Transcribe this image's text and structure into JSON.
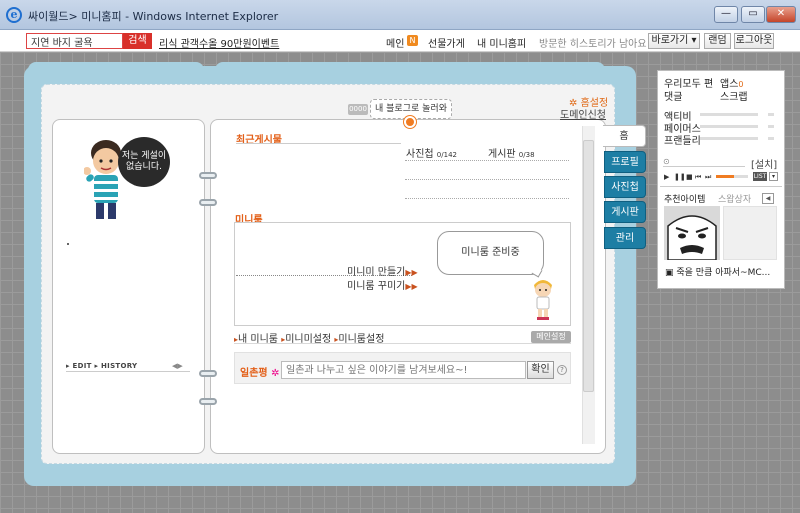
{
  "window": {
    "title": "싸이월드> 미니홈피 - Windows Internet Explorer",
    "btn_minimize": "—",
    "btn_maximize": "▭",
    "btn_close": "✕"
  },
  "topbar": {
    "search_value": "지연 바지 굴욕",
    "search_button": "검색",
    "promo_link": "리식 관객수올 90만원이벤트",
    "nav": {
      "main": "메인",
      "new_badge": "N",
      "gift_shop": "선물가게",
      "my_minihompy": "내 미니홈피",
      "visit_history": "방문한 히스토리가 남아요",
      "shortcut": "바로가기 ▾",
      "random": "랜덤",
      "logout": "로그아웃"
    }
  },
  "left_page": {
    "speech_text": "저는 게설이 없습니다.",
    "edit_history": "▸ EDIT  ▸ HISTORY"
  },
  "header": {
    "counter": "0000",
    "blog_banner": "내 블로그로 놀러와",
    "home_settings": "✲ 홈설정",
    "domain_apply": "도메인신청"
  },
  "recent": {
    "title": "최근게시물",
    "photo_label": "사진첩",
    "photo_count": "0/142",
    "board_label": "게시판",
    "board_count": "0/38"
  },
  "miniroom": {
    "title": "미니룸",
    "bubble": "미니룸 준비중",
    "make_link": "미니미 만들기",
    "decorate_link": "미니룸 꾸미기",
    "tab_my_room": "내 미니룸",
    "tab_minimi_settings": "미니미설정",
    "tab_room_settings": "미니룸설정",
    "main_set_button": "메인설정"
  },
  "guestbook": {
    "label": "일촌평",
    "placeholder": "일촌과 나누고 싶은 이야기를 남겨보세요~!",
    "confirm": "확인"
  },
  "side_tabs": [
    "홈",
    "프로필",
    "사진첩",
    "게시판",
    "관리"
  ],
  "right_panel": {
    "everyone": "우리모두 편",
    "apps": "앱스",
    "apps_count": "0",
    "comments": "댓글",
    "scrap": "스크랩",
    "activity": "액티비",
    "famous": "페이머스",
    "friendly": "프랜들리",
    "player_settings": "[설치]",
    "list_button": "LIST",
    "recommended_items": "추천아이템",
    "sold_out": "스왑상자",
    "item_caption": "죽을 만큼 아파서~MC..."
  },
  "colors": {
    "accent_orange": "#e35f18",
    "tab_blue": "#1d7ea4",
    "book_blue": "#a7d0e0",
    "search_red": "#d8302a"
  }
}
